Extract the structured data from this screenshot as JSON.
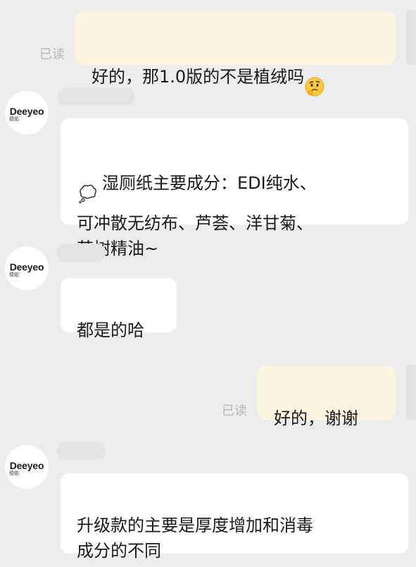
{
  "messages": [
    {
      "direction": "out",
      "text": "好的，那1.0版的不是植绒吗",
      "emoji": "thinking-face",
      "read_label": "已读"
    },
    {
      "direction": "in",
      "avatar_brand": "Deeyeo",
      "avatar_sub": "德佑",
      "emoji": "thought-balloon",
      "text": "湿厕纸主要成分：EDI纯水、\n可冲散无纺布、芦荟、洋甘菊、\n茶树精油~"
    },
    {
      "direction": "in",
      "avatar_brand": "Deeyeo",
      "avatar_sub": "德佑",
      "text": "都是的哈"
    },
    {
      "direction": "out",
      "text": "好的，谢谢",
      "read_label": "已读"
    },
    {
      "direction": "in",
      "avatar_brand": "Deeyeo",
      "avatar_sub": "德佑",
      "text": "升级款的主要是厚度增加和消毒\n成分的不同"
    }
  ],
  "colors": {
    "background": "#ededed",
    "outgoing_bubble": "#fdf5e0",
    "incoming_bubble": "#ffffff",
    "read_label": "#b8b8b8"
  }
}
